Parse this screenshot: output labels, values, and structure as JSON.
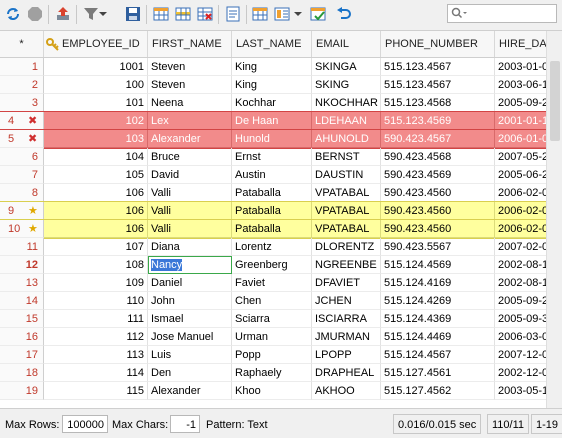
{
  "columns": [
    "",
    "EMPLOYEE_ID",
    "FIRST_NAME",
    "LAST_NAME",
    "EMAIL",
    "PHONE_NUMBER",
    "HIRE_DATE"
  ],
  "rows": [
    {
      "n": "1",
      "id": "1001",
      "first": "Steven",
      "last": "King",
      "email": "SKINGA",
      "phone": "515.123.4567",
      "hire": "2003-01-0",
      "state": ""
    },
    {
      "n": "2",
      "id": "100",
      "first": "Steven",
      "last": "King",
      "email": "SKING",
      "phone": "515.123.4567",
      "hire": "2003-06-1",
      "state": ""
    },
    {
      "n": "3",
      "id": "101",
      "first": "Neena",
      "last": "Kochhar",
      "email": "NKOCHHAR",
      "phone": "515.123.4568",
      "hire": "2005-09-2",
      "state": ""
    },
    {
      "n": "4",
      "id": "102",
      "first": "Lex",
      "last": "De Haan",
      "email": "LDEHAAN",
      "phone": "515.123.4569",
      "hire": "2001-01-1",
      "state": "del"
    },
    {
      "n": "5",
      "id": "103",
      "first": "Alexander",
      "last": "Hunold",
      "email": "AHUNOLD",
      "phone": "590.423.4567",
      "hire": "2006-01-0",
      "state": "del"
    },
    {
      "n": "6",
      "id": "104",
      "first": "Bruce",
      "last": "Ernst",
      "email": "BERNST",
      "phone": "590.423.4568",
      "hire": "2007-05-2",
      "state": ""
    },
    {
      "n": "7",
      "id": "105",
      "first": "David",
      "last": "Austin",
      "email": "DAUSTIN",
      "phone": "590.423.4569",
      "hire": "2005-06-2",
      "state": ""
    },
    {
      "n": "8",
      "id": "106",
      "first": "Valli",
      "last": "Pataballa",
      "email": "VPATABAL",
      "phone": "590.423.4560",
      "hire": "2006-02-0",
      "state": ""
    },
    {
      "n": "9",
      "id": "106",
      "first": "Valli",
      "last": "Pataballa",
      "email": "VPATABAL",
      "phone": "590.423.4560",
      "hire": "2006-02-0",
      "state": "dup"
    },
    {
      "n": "10",
      "id": "106",
      "first": "Valli",
      "last": "Pataballa",
      "email": "VPATABAL",
      "phone": "590.423.4560",
      "hire": "2006-02-0",
      "state": "dup"
    },
    {
      "n": "11",
      "id": "107",
      "first": "Diana",
      "last": "Lorentz",
      "email": "DLORENTZ",
      "phone": "590.423.5567",
      "hire": "2007-02-0",
      "state": ""
    },
    {
      "n": "12",
      "id": "108",
      "first": "Nancy",
      "last": "Greenberg",
      "email": "NGREENBE",
      "phone": "515.124.4569",
      "hire": "2002-08-1",
      "state": "edit"
    },
    {
      "n": "13",
      "id": "109",
      "first": "Daniel",
      "last": "Faviet",
      "email": "DFAVIET",
      "phone": "515.124.4169",
      "hire": "2002-08-1",
      "state": ""
    },
    {
      "n": "14",
      "id": "110",
      "first": "John",
      "last": "Chen",
      "email": "JCHEN",
      "phone": "515.124.4269",
      "hire": "2005-09-2",
      "state": ""
    },
    {
      "n": "15",
      "id": "111",
      "first": "Ismael",
      "last": "Sciarra",
      "email": "ISCIARRA",
      "phone": "515.124.4369",
      "hire": "2005-09-3",
      "state": ""
    },
    {
      "n": "16",
      "id": "112",
      "first": "Jose Manuel",
      "last": "Urman",
      "email": "JMURMAN",
      "phone": "515.124.4469",
      "hire": "2006-03-0",
      "state": ""
    },
    {
      "n": "17",
      "id": "113",
      "first": "Luis",
      "last": "Popp",
      "email": "LPOPP",
      "phone": "515.124.4567",
      "hire": "2007-12-0",
      "state": ""
    },
    {
      "n": "18",
      "id": "114",
      "first": "Den",
      "last": "Raphaely",
      "email": "DRAPHEAL",
      "phone": "515.127.4561",
      "hire": "2002-12-0",
      "state": ""
    },
    {
      "n": "19",
      "id": "115",
      "first": "Alexander",
      "last": "Khoo",
      "email": "AKHOO",
      "phone": "515.127.4562",
      "hire": "2003-05-1",
      "state": ""
    }
  ],
  "status": {
    "max_rows_label": "Max Rows:",
    "max_rows_value": "100000",
    "max_chars_label": "Max Chars:",
    "max_chars_value": "-1",
    "pattern_label": "Pattern: Text",
    "timing": "0.016/0.015 sec",
    "counts": "110/11",
    "range": "1-19"
  },
  "colors": {
    "deleted_row": "#f28b8b",
    "duplicate_row": "#ffff9e",
    "row_number": "#c0392b",
    "selection": "#3a78d8"
  }
}
